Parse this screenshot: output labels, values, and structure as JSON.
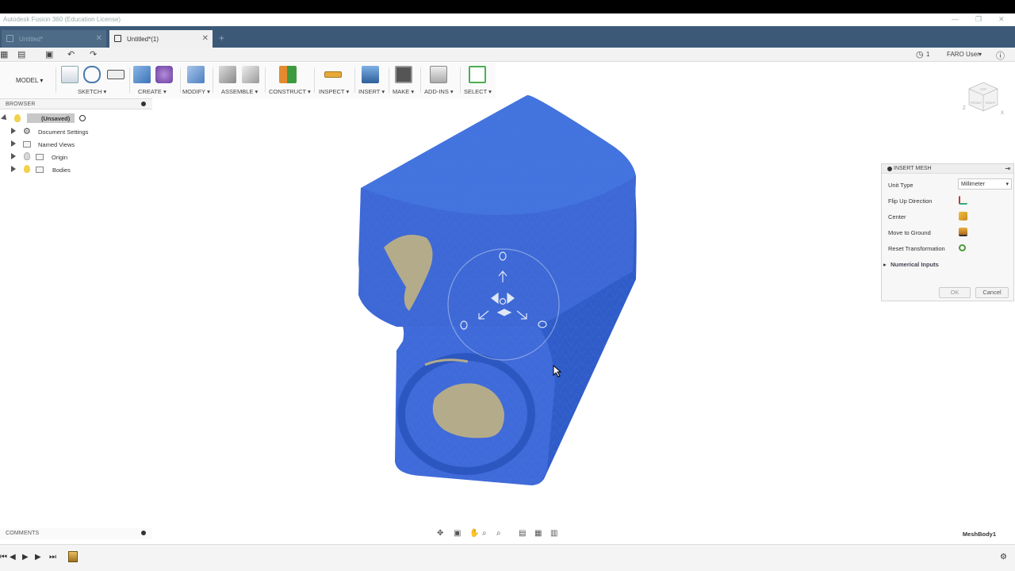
{
  "window": {
    "title": "Autodesk Fusion 360 (Education License)",
    "controls": [
      "—",
      "❐",
      "✕"
    ]
  },
  "tabs": [
    {
      "label": "Untitled*",
      "active": false
    },
    {
      "label": "Untitled*(1)",
      "active": true
    }
  ],
  "quick_access": {
    "history_count": "1",
    "user": "FARO User",
    "help": "?"
  },
  "ribbon": {
    "workspace": "MODEL",
    "groups": [
      "SKETCH",
      "CREATE",
      "MODIFY",
      "ASSEMBLE",
      "CONSTRUCT",
      "INSPECT",
      "INSERT",
      "MAKE",
      "ADD-INS",
      "SELECT"
    ]
  },
  "browser": {
    "header": "BROWSER",
    "root": "(Unsaved)",
    "items": [
      "Document Settings",
      "Named Views",
      "Origin",
      "Bodies"
    ]
  },
  "comments": {
    "header": "COMMENTS"
  },
  "viewcube": {
    "faces": [
      "TOP",
      "FRONT",
      "RIGHT"
    ],
    "axes": [
      "Z",
      "X"
    ]
  },
  "insert_mesh": {
    "title": "INSERT MESH",
    "unit_type_label": "Unit Type",
    "unit_type_value": "Millimeter",
    "flip_up_label": "Flip Up Direction",
    "center_label": "Center",
    "move_ground_label": "Move to Ground",
    "reset_label": "Reset Transformation",
    "numerical_label": "Numerical Inputs",
    "ok": "OK",
    "cancel": "Cancel"
  },
  "status": {
    "selection": "MeshBody1"
  },
  "colors": {
    "mesh_blue": "#3e6bd8",
    "tab_bar": "#3c5a78",
    "cavity": "#b4ab8a"
  }
}
